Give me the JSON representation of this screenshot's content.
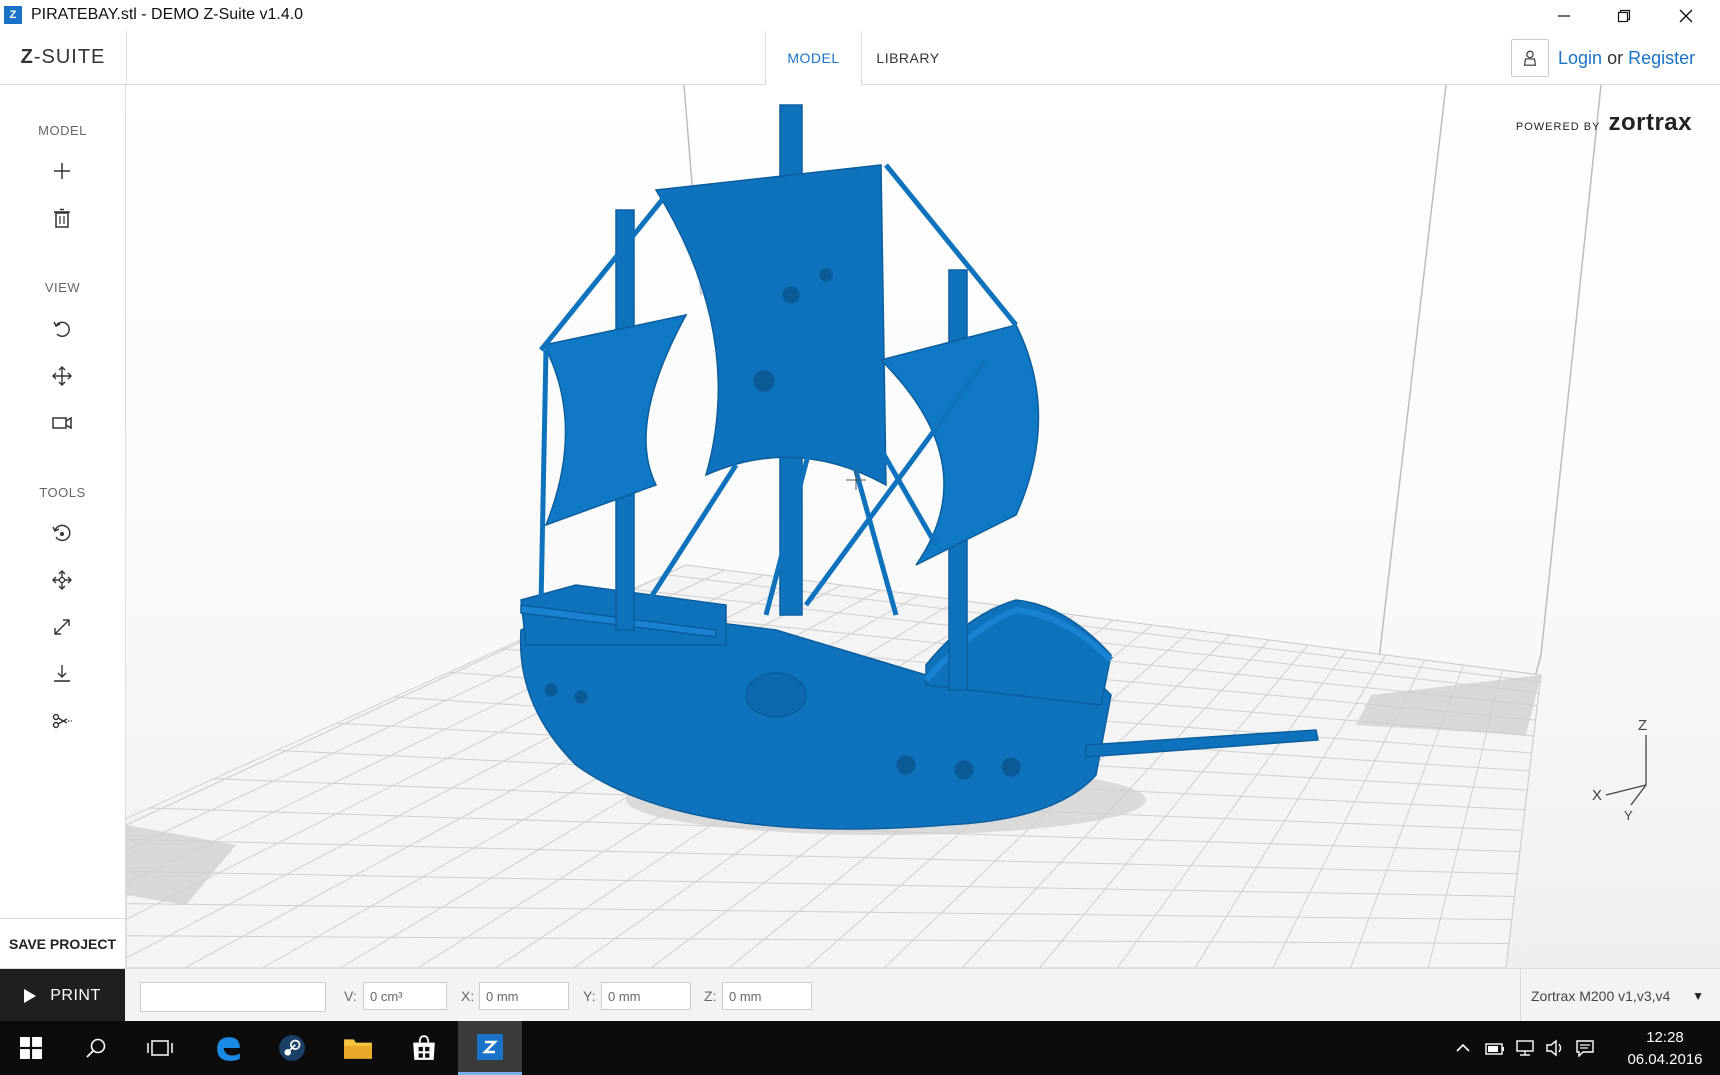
{
  "window": {
    "icon_letter": "Z",
    "title": "PIRATEBAY.stl - DEMO Z-Suite v1.4.0"
  },
  "header": {
    "logo_prefix": "Z",
    "logo_rest": "-SUITE",
    "tabs": [
      {
        "label": "MODEL",
        "active": true
      },
      {
        "label": "LIBRARY",
        "active": false
      }
    ],
    "login": "Login",
    "or": "or",
    "register": "Register"
  },
  "sidebar": {
    "sections": {
      "model": "MODEL",
      "view": "VIEW",
      "tools": "TOOLS"
    },
    "model_tools": [
      "add-icon",
      "trash-icon"
    ],
    "view_tools": [
      "rotate-view-icon",
      "pan-icon",
      "camera-icon"
    ],
    "tools": [
      "rotate-model-icon",
      "move-model-icon",
      "scale-icon",
      "place-on-bed-icon",
      "cut-icon"
    ],
    "save_label": "SAVE PROJECT"
  },
  "viewport": {
    "powered_by": "POWERED BY",
    "brand": "zortrax",
    "model_color": "#0f72bd",
    "axes": {
      "x": "X",
      "y": "Y",
      "z": "Z"
    }
  },
  "bottom": {
    "print_label": "PRINT",
    "fields": [
      {
        "label": "V:",
        "value": "0 cm³"
      },
      {
        "label": "X:",
        "value": "0 mm"
      },
      {
        "label": "Y:",
        "value": "0 mm"
      },
      {
        "label": "Z:",
        "value": "0 mm"
      }
    ],
    "printer": "Zortrax M200 v1,v3,v4"
  },
  "taskbar": {
    "time": "12:28",
    "date": "06.04.2016"
  }
}
